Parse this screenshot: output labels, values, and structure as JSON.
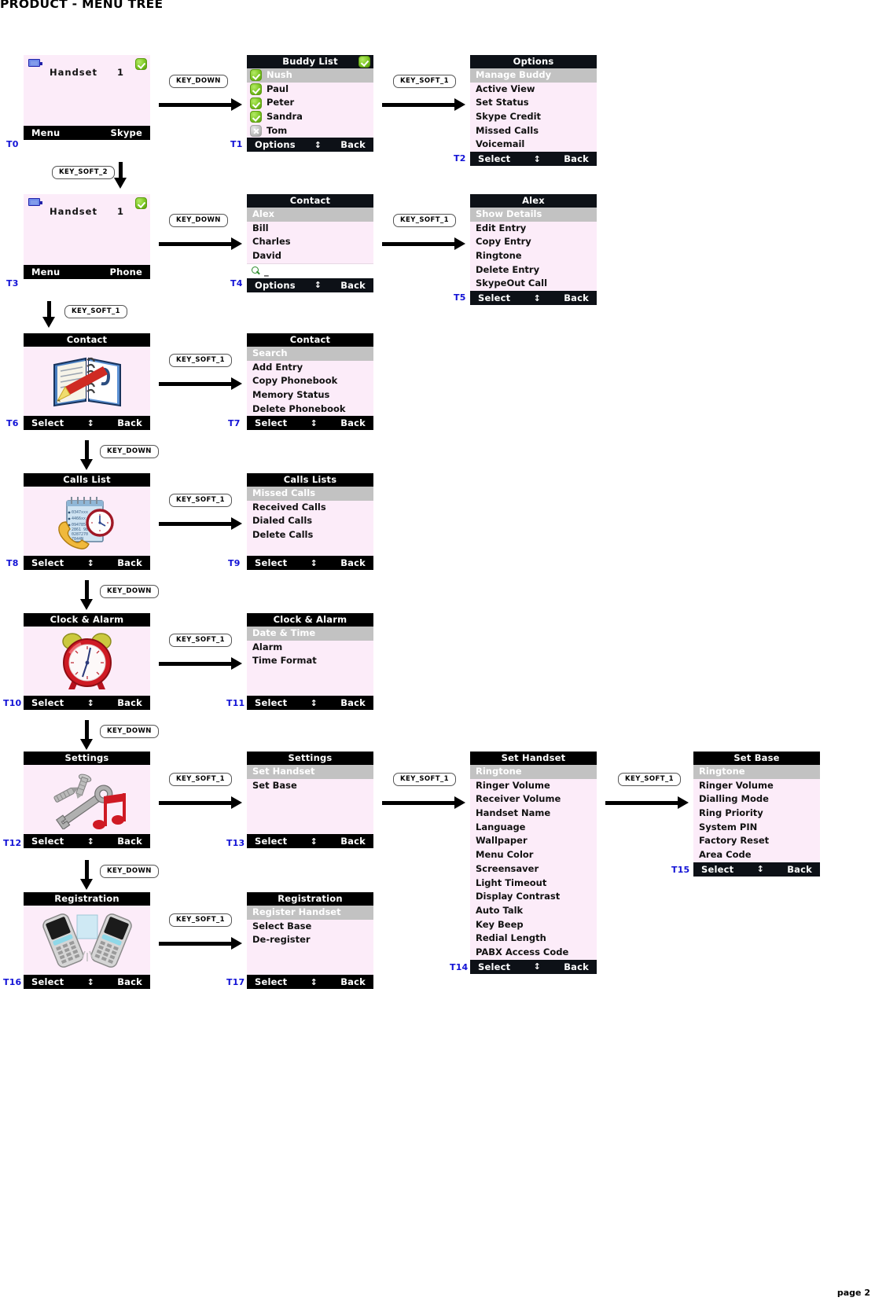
{
  "document": {
    "title": "PRODUCT - MENU TREE",
    "page_footer": "page 2"
  },
  "soft_labels": {
    "select": "Select",
    "back": "Back",
    "options": "Options",
    "menu": "Menu",
    "skype": "Skype",
    "phone": "Phone",
    "updown": "↕"
  },
  "keys": {
    "key_down": "KEY_DOWN",
    "key_soft_1": "KEY_SOFT_1",
    "key_soft_2": "KEY_SOFT_2"
  },
  "screens": {
    "t0": {
      "id": "T0",
      "type": "idle",
      "handset_label": "Handset",
      "handset_number": "1",
      "soft_left": "Menu",
      "soft_right": "Skype",
      "status_icon": "check-badge-icon",
      "battery_icon": "battery-icon"
    },
    "t1": {
      "id": "T1",
      "type": "list",
      "title": "Buddy List",
      "title_icon": "check-badge-icon",
      "items": [
        {
          "label": "Nush",
          "icon": "check-badge-icon",
          "selected": true
        },
        {
          "label": "Paul",
          "icon": "check-badge-icon",
          "selected": false
        },
        {
          "label": "Peter",
          "icon": "check-badge-icon",
          "selected": false
        },
        {
          "label": "Sandra",
          "icon": "check-badge-icon",
          "selected": false
        },
        {
          "label": "Tom",
          "icon": "x-badge-icon",
          "selected": false
        }
      ],
      "soft_left": "Options",
      "soft_right": "Back"
    },
    "t2": {
      "id": "T2",
      "type": "list",
      "title": "Options",
      "items": [
        {
          "label": "Manage Buddy",
          "selected": true
        },
        {
          "label": "Active View",
          "selected": false
        },
        {
          "label": "Set Status",
          "selected": false
        },
        {
          "label": "Skype Credit",
          "selected": false
        },
        {
          "label": "Missed Calls",
          "selected": false
        },
        {
          "label": "Voicemail",
          "selected": false
        }
      ],
      "soft_left": "Select",
      "soft_right": "Back"
    },
    "t3": {
      "id": "T3",
      "type": "idle",
      "handset_label": "Handset",
      "handset_number": "1",
      "soft_left": "Menu",
      "soft_right": "Phone",
      "status_icon": "check-badge-icon",
      "battery_icon": "battery-icon"
    },
    "t4": {
      "id": "T4",
      "type": "list",
      "title": "Contact",
      "items": [
        {
          "label": "Alex",
          "selected": true
        },
        {
          "label": "Bill",
          "selected": false
        },
        {
          "label": "Charles",
          "selected": false
        },
        {
          "label": "David",
          "selected": false
        }
      ],
      "search_value": "_",
      "search_icon": "magnifier-icon",
      "soft_left": "Options",
      "soft_right": "Back"
    },
    "t5": {
      "id": "T5",
      "type": "list",
      "title": "Alex",
      "items": [
        {
          "label": "Show Details",
          "selected": true
        },
        {
          "label": "Edit Entry",
          "selected": false
        },
        {
          "label": "Copy Entry",
          "selected": false
        },
        {
          "label": "Ringtone",
          "selected": false
        },
        {
          "label": "Delete Entry",
          "selected": false
        },
        {
          "label": "SkypeOut Call",
          "selected": false
        }
      ],
      "soft_left": "Select",
      "soft_right": "Back"
    },
    "t6": {
      "id": "T6",
      "type": "icon",
      "title": "Contact",
      "icon": "phonebook-icon",
      "soft_left": "Select",
      "soft_right": "Back"
    },
    "t7": {
      "id": "T7",
      "type": "list",
      "title": "Contact",
      "items": [
        {
          "label": "Search",
          "selected": true
        },
        {
          "label": "Add Entry",
          "selected": false
        },
        {
          "label": "Copy Phonebook",
          "selected": false
        },
        {
          "label": "Memory Status",
          "selected": false
        },
        {
          "label": "Delete Phonebook",
          "selected": false
        }
      ],
      "soft_left": "Select",
      "soft_right": "Back"
    },
    "t8": {
      "id": "T8",
      "type": "icon",
      "title": "Calls List",
      "icon": "calls-list-icon",
      "soft_left": "Select",
      "soft_right": "Back"
    },
    "t9": {
      "id": "T9",
      "type": "list",
      "title": "Calls Lists",
      "items": [
        {
          "label": "Missed Calls",
          "selected": true
        },
        {
          "label": "Received Calls",
          "selected": false
        },
        {
          "label": "Dialed Calls",
          "selected": false
        },
        {
          "label": "Delete Calls",
          "selected": false
        }
      ],
      "soft_left": "Select",
      "soft_right": "Back"
    },
    "t10": {
      "id": "T10",
      "type": "icon",
      "title": "Clock & Alarm",
      "icon": "alarm-clock-icon",
      "soft_left": "Select",
      "soft_right": "Back"
    },
    "t11": {
      "id": "T11",
      "type": "list",
      "title": "Clock & Alarm",
      "items": [
        {
          "label": "Date & Time",
          "selected": true
        },
        {
          "label": "Alarm",
          "selected": false
        },
        {
          "label": "Time Format",
          "selected": false
        }
      ],
      "soft_left": "Select",
      "soft_right": "Back"
    },
    "t12": {
      "id": "T12",
      "type": "icon",
      "title": "Settings",
      "icon": "tools-icon",
      "soft_left": "Select",
      "soft_right": "Back"
    },
    "t13": {
      "id": "T13",
      "type": "list",
      "title": "Settings",
      "items": [
        {
          "label": "Set Handset",
          "selected": true
        },
        {
          "label": "Set Base",
          "selected": false
        }
      ],
      "soft_left": "Select",
      "soft_right": "Back"
    },
    "t14": {
      "id": "T14",
      "type": "list",
      "title": "Set Handset",
      "items": [
        {
          "label": "Ringtone",
          "selected": true
        },
        {
          "label": "Ringer Volume",
          "selected": false
        },
        {
          "label": "Receiver Volume",
          "selected": false
        },
        {
          "label": "Handset Name",
          "selected": false
        },
        {
          "label": "Language",
          "selected": false
        },
        {
          "label": "Wallpaper",
          "selected": false
        },
        {
          "label": "Menu Color",
          "selected": false
        },
        {
          "label": "Screensaver",
          "selected": false
        },
        {
          "label": "Light Timeout",
          "selected": false
        },
        {
          "label": "Display Contrast",
          "selected": false
        },
        {
          "label": "Auto Talk",
          "selected": false
        },
        {
          "label": "Key Beep",
          "selected": false
        },
        {
          "label": "Redial Length",
          "selected": false
        },
        {
          "label": "PABX Access Code",
          "selected": false
        }
      ],
      "soft_left": "Select",
      "soft_right": "Back"
    },
    "t15": {
      "id": "T15",
      "type": "list",
      "title": "Set Base",
      "items": [
        {
          "label": "Ringtone",
          "selected": true
        },
        {
          "label": "Ringer Volume",
          "selected": false
        },
        {
          "label": "Dialling Mode",
          "selected": false
        },
        {
          "label": "Ring Priority",
          "selected": false
        },
        {
          "label": "System PIN",
          "selected": false
        },
        {
          "label": "Factory Reset",
          "selected": false
        },
        {
          "label": "Area Code",
          "selected": false
        }
      ],
      "soft_left": "Select",
      "soft_right": "Back"
    },
    "t16": {
      "id": "T16",
      "type": "icon",
      "title": "Registration",
      "icon": "two-handsets-icon",
      "soft_left": "Select",
      "soft_right": "Back"
    },
    "t17": {
      "id": "T17",
      "type": "list",
      "title": "Registration",
      "items": [
        {
          "label": "Register Handset",
          "selected": true
        },
        {
          "label": "Select Base",
          "selected": false
        },
        {
          "label": "De-register",
          "selected": false
        }
      ],
      "soft_left": "Select",
      "soft_right": "Back"
    }
  }
}
